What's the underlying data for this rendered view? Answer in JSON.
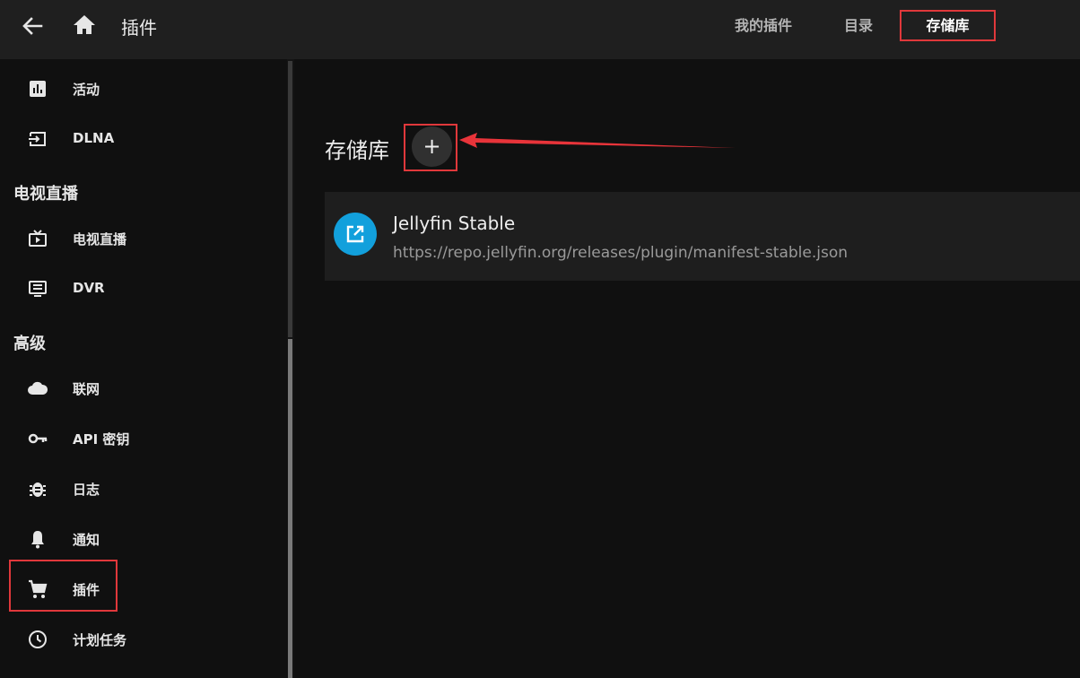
{
  "header": {
    "title": "插件",
    "tabs": [
      {
        "label": "我的插件",
        "active": false
      },
      {
        "label": "目录",
        "active": false
      },
      {
        "label": "存储库",
        "active": true
      }
    ]
  },
  "sidebar": {
    "items_top": [
      {
        "label": "活动",
        "icon": "bar-chart-icon"
      },
      {
        "label": "DLNA",
        "icon": "input-icon"
      }
    ],
    "section_live_tv": "电视直播",
    "items_live_tv": [
      {
        "label": "电视直播",
        "icon": "live-tv-icon"
      },
      {
        "label": "DVR",
        "icon": "dvr-icon"
      }
    ],
    "section_advanced": "高级",
    "items_advanced": [
      {
        "label": "联网",
        "icon": "cloud-icon"
      },
      {
        "label": "API 密钥",
        "icon": "key-icon"
      },
      {
        "label": "日志",
        "icon": "bug-icon"
      },
      {
        "label": "通知",
        "icon": "bell-icon"
      },
      {
        "label": "插件",
        "icon": "cart-icon",
        "active": true
      },
      {
        "label": "计划任务",
        "icon": "clock-icon"
      }
    ]
  },
  "main": {
    "title": "存储库",
    "add_label": "+",
    "repositories": [
      {
        "name": "Jellyfin Stable",
        "url": "https://repo.jellyfin.org/releases/plugin/manifest-stable.json"
      }
    ]
  },
  "colors": {
    "background": "#101010",
    "header": "#1f1f1f",
    "card": "#1e1e1e",
    "accent_blue": "#12a0dc",
    "highlight_red": "#e0383b"
  }
}
